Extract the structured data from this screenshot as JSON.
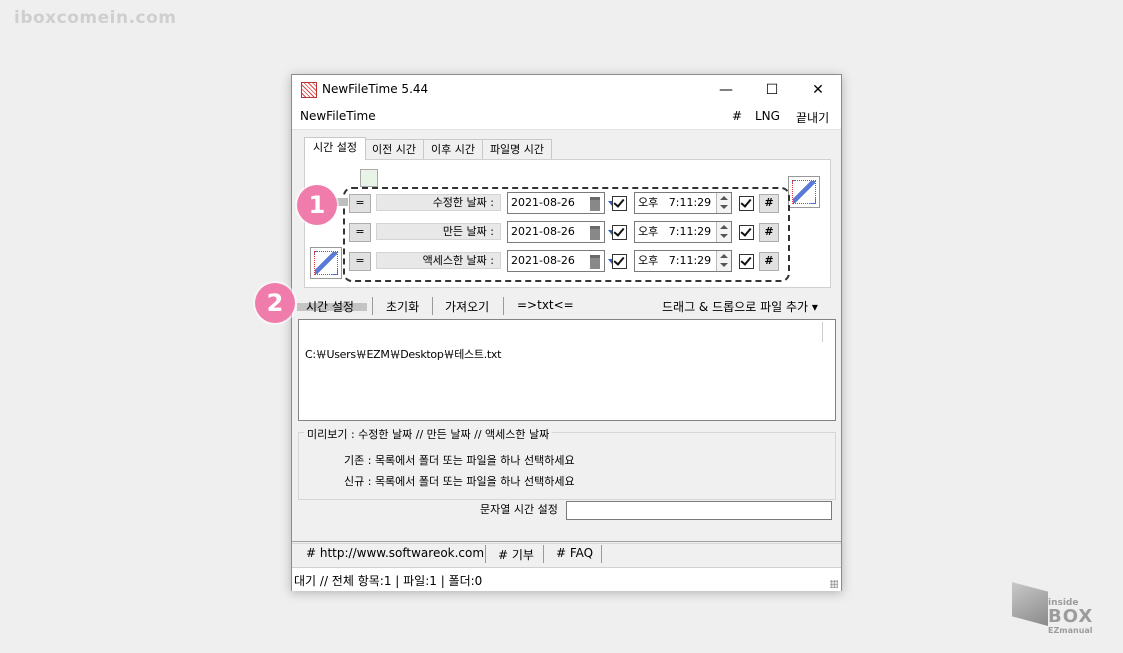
{
  "watermark": "iboxcomein.com",
  "window": {
    "title": "NewFileTime 5.44",
    "controls": {
      "minimize": "—",
      "maximize": "☐",
      "close": "✕"
    }
  },
  "menubar": {
    "app_name": "NewFileTime",
    "hash": "#",
    "lng": "LNG",
    "exit": "끝내기"
  },
  "tabs": [
    "시간 설정",
    "이전 시간",
    "이후 시간",
    "파일명 시간"
  ],
  "time_rows": [
    {
      "label": "수정한 날짜 :",
      "eq": "=",
      "date": "2021-08-26",
      "ampm": "오후",
      "time": "7:11:29",
      "hash": "#"
    },
    {
      "label": "만든 날짜 :",
      "eq": "=",
      "date": "2021-08-26",
      "ampm": "오후",
      "time": "7:11:29",
      "hash": "#"
    },
    {
      "label": "액세스한 날짜 :",
      "eq": "=",
      "date": "2021-08-26",
      "ampm": "오후",
      "time": "7:11:29",
      "hash": "#"
    }
  ],
  "badges": [
    "1",
    "2"
  ],
  "toolbar": {
    "set_time": "시간 설정",
    "reset": "초기화",
    "import": "가져오기",
    "txt": "=>txt<=",
    "drag_drop": "드래그 & 드롭으로 파일 추가"
  },
  "file_list": [
    "C:￦Users￦EZM￦Desktop￦테스트.txt"
  ],
  "preview": {
    "legend": "미리보기 :   수정한 날짜   //   만든 날짜   //   액세스한 날짜",
    "existing": "기존 : 목록에서 폴더 또는 파일을 하나 선택하세요",
    "new": "신규 : 목록에서 폴더 또는 파일을 하나 선택하세요"
  },
  "string_time": {
    "label": "문자열 시간 설정",
    "value": ""
  },
  "footer_links": [
    "# http://www.softwareok.com",
    "# 기부",
    "# FAQ"
  ],
  "status": "대기 // 전체 항목:1  |  파일:1   |  폴더:0",
  "brand": {
    "line1": "inside",
    "line2": "BOX",
    "line3": "EZmanual"
  }
}
